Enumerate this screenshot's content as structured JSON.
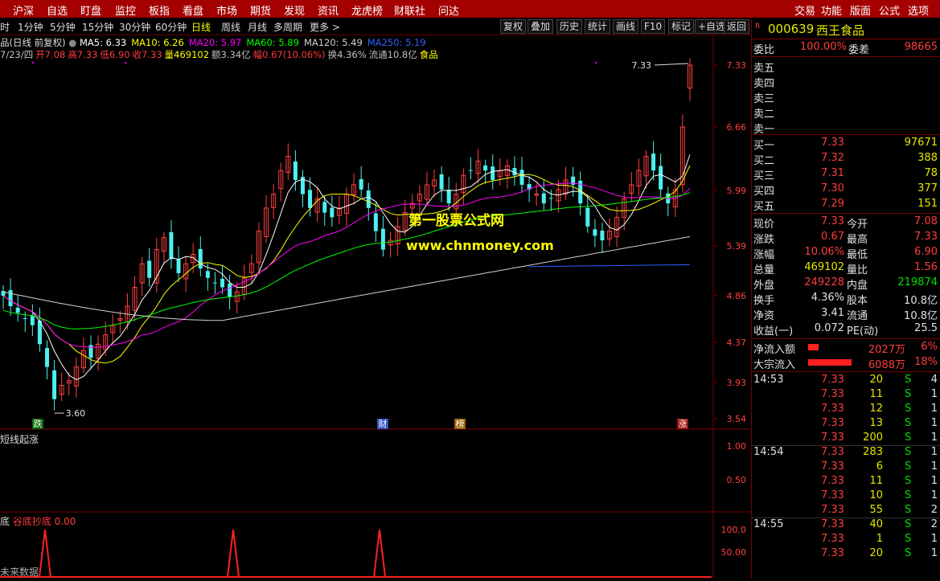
{
  "top_menu": [
    "沪深",
    "自选",
    "盯盘",
    "监控",
    "板指",
    "看盘",
    "市场",
    "期货",
    "发现",
    "资讯",
    "龙虎榜",
    "财联社",
    "问达"
  ],
  "top_right_menu": [
    "交易",
    "功能",
    "版面",
    "公式",
    "选项"
  ],
  "periods": [
    "时",
    "1分钟",
    "5分钟",
    "15分钟",
    "30分钟",
    "60分钟",
    "日线",
    "周线",
    "月线",
    "多周期",
    "更多 >"
  ],
  "active_period": "日线",
  "tool_buttons": [
    "复权",
    "叠加",
    "历史",
    "统计",
    "画线",
    "F10",
    "标记",
    "+自选",
    "返回"
  ],
  "chart_header": {
    "title": "品(日线 前复权)",
    "ma": [
      {
        "label": "MA5: 6.33",
        "color": "#ffffff"
      },
      {
        "label": "MA10: 6.26",
        "color": "#ffff00"
      },
      {
        "label": "MA20: 5.97",
        "color": "#ff00ff"
      },
      {
        "label": "MA60: 5.89",
        "color": "#00ff00"
      },
      {
        "label": "MA120: 5.49",
        "color": "#d0d0d0"
      },
      {
        "label": "MA250: 5.19",
        "color": "#3060ff"
      }
    ],
    "info": [
      {
        "t": "7/23/四",
        "c": "#c0c0c0"
      },
      {
        "t": "开7.08",
        "c": "#ff3c3c"
      },
      {
        "t": "高7.33",
        "c": "#ff3c3c"
      },
      {
        "t": "低6.90",
        "c": "#ff3c3c"
      },
      {
        "t": "收7.33",
        "c": "#ff3c3c"
      },
      {
        "t": "量469102",
        "c": "#ffff00"
      },
      {
        "t": "额3.34亿",
        "c": "#c0c0c0"
      },
      {
        "t": "幅0.67(10.06%)",
        "c": "#ff3c3c"
      },
      {
        "t": "换4.36%",
        "c": "#c0c0c0"
      },
      {
        "t": "流通10.8亿",
        "c": "#c0c0c0"
      },
      {
        "t": "食品",
        "c": "#ffff00"
      }
    ]
  },
  "watermark": {
    "line1": "第一股票公式网",
    "line2": "www.chnmoney.com"
  },
  "price_axis": [
    "7.33",
    "6.66",
    "5.99",
    "5.39",
    "4.86",
    "4.37",
    "3.93",
    "3.54"
  ],
  "annotations": {
    "high": "7.33",
    "low": "3.60"
  },
  "event_marks": [
    {
      "label": "跌",
      "bg": "#0a6a0a"
    },
    {
      "label": "财",
      "bg": "#3050c0"
    },
    {
      "label": "榜",
      "bg": "#a06000"
    },
    {
      "label": "涨",
      "bg": "#a01010"
    }
  ],
  "sub1": {
    "title": "短线起涨",
    "axis": [
      "1.00",
      "0.50"
    ]
  },
  "sub2": {
    "prefix": "底",
    "name": "谷底抄底",
    "value": "0.00",
    "axis": [
      "100.0",
      "50.00"
    ],
    "footer": "未来数据"
  },
  "chart_data": {
    "type": "candlestick",
    "symbol": "000639",
    "last": {
      "date": "7/23",
      "open": 7.08,
      "high": 7.33,
      "low": 6.9,
      "close": 7.33,
      "volume": 469102
    },
    "ma": {
      "MA5": 6.33,
      "MA10": 6.26,
      "MA20": 5.97,
      "MA60": 5.89,
      "MA120": 5.49,
      "MA250": 5.19
    },
    "price_ticks": [
      7.33,
      6.66,
      5.99,
      5.39,
      4.86,
      4.37,
      3.93,
      3.54
    ],
    "closes": [
      4.86,
      4.75,
      4.68,
      4.62,
      4.55,
      4.35,
      4.1,
      3.75,
      3.9,
      3.95,
      4.1,
      4.28,
      4.2,
      4.35,
      4.45,
      4.55,
      4.62,
      4.75,
      4.95,
      5.2,
      5.05,
      5.35,
      5.48,
      5.25,
      5.1,
      5.2,
      5.3,
      5.15,
      5.05,
      5.0,
      4.95,
      4.85,
      4.9,
      5.05,
      5.2,
      5.55,
      5.8,
      5.95,
      6.2,
      6.35,
      6.1,
      5.95,
      5.8,
      5.9,
      5.75,
      5.7,
      5.8,
      5.95,
      6.05,
      6.0,
      5.8,
      5.55,
      5.35,
      5.45,
      5.6,
      5.75,
      5.85,
      5.95,
      6.05,
      6.1,
      6.0,
      5.85,
      5.95,
      6.15,
      6.2,
      6.3,
      6.2,
      6.1,
      6.2,
      6.25,
      6.15,
      6.05,
      6.0,
      5.95,
      5.85,
      5.9,
      6.0,
      6.1,
      6.05,
      5.85,
      5.6,
      5.5,
      5.45,
      5.55,
      5.7,
      5.9,
      6.05,
      6.2,
      6.35,
      6.2,
      6.0,
      5.85,
      6.0,
      6.66,
      7.33
    ],
    "sub2_peaks_pct": [
      100,
      100,
      100
    ]
  },
  "quote": {
    "code": "000639",
    "name": "西王食品",
    "weibi": {
      "label": "委比",
      "value": "100.00%",
      "label2": "委差",
      "value2": "98665"
    },
    "sells": [
      {
        "label": "卖五"
      },
      {
        "label": "卖四"
      },
      {
        "label": "卖三"
      },
      {
        "label": "卖二"
      },
      {
        "label": "卖一"
      }
    ],
    "buys": [
      {
        "label": "买一",
        "price": "7.33",
        "vol": "97671"
      },
      {
        "label": "买二",
        "price": "7.32",
        "vol": "388"
      },
      {
        "label": "买三",
        "price": "7.31",
        "vol": "78"
      },
      {
        "label": "买四",
        "price": "7.30",
        "vol": "377"
      },
      {
        "label": "买五",
        "price": "7.29",
        "vol": "151"
      }
    ],
    "stats": [
      {
        "l1": "现价",
        "v1": "7.33",
        "c1": "red",
        "l2": "今开",
        "v2": "7.08",
        "c2": "red"
      },
      {
        "l1": "涨跌",
        "v1": "0.67",
        "c1": "red",
        "l2": "最高",
        "v2": "7.33",
        "c2": "red"
      },
      {
        "l1": "涨幅",
        "v1": "10.06%",
        "c1": "red",
        "l2": "最低",
        "v2": "6.90",
        "c2": "red"
      },
      {
        "l1": "总量",
        "v1": "469102",
        "c1": "yel",
        "l2": "量比",
        "v2": "1.56",
        "c2": "red"
      },
      {
        "l1": "外盘",
        "v1": "249228",
        "c1": "red",
        "l2": "内盘",
        "v2": "219874",
        "c2": "grn"
      },
      {
        "l1": "换手",
        "v1": "4.36%",
        "c1": "wht",
        "l2": "股本",
        "v2": "10.8亿",
        "c2": "wht"
      },
      {
        "l1": "净资",
        "v1": "3.41",
        "c1": "wht",
        "l2": "流通",
        "v2": "10.8亿",
        "c2": "wht"
      },
      {
        "l1": "收益(一)",
        "v1": "0.072",
        "c1": "wht",
        "l2": "PE(动)",
        "v2": "25.5",
        "c2": "wht"
      }
    ],
    "flows": [
      {
        "label": "净流入额",
        "value": "2027万",
        "pct": "6%",
        "bar": 0.22
      },
      {
        "label": "大宗流入",
        "value": "6088万",
        "pct": "18%",
        "bar": 0.9
      }
    ],
    "ticks": [
      {
        "time": "14:53",
        "price": "7.33",
        "vol": "20",
        "bs": "S",
        "n": "4"
      },
      {
        "time": "",
        "price": "7.33",
        "vol": "11",
        "bs": "S",
        "n": "1"
      },
      {
        "time": "",
        "price": "7.33",
        "vol": "12",
        "bs": "S",
        "n": "1"
      },
      {
        "time": "",
        "price": "7.33",
        "vol": "13",
        "bs": "S",
        "n": "1"
      },
      {
        "time": "",
        "price": "7.33",
        "vol": "200",
        "bs": "S",
        "n": "1"
      },
      {
        "time": "14:54",
        "price": "7.33",
        "vol": "283",
        "bs": "S",
        "n": "1"
      },
      {
        "time": "",
        "price": "7.33",
        "vol": "6",
        "bs": "S",
        "n": "1"
      },
      {
        "time": "",
        "price": "7.33",
        "vol": "11",
        "bs": "S",
        "n": "1"
      },
      {
        "time": "",
        "price": "7.33",
        "vol": "10",
        "bs": "S",
        "n": "1"
      },
      {
        "time": "",
        "price": "7.33",
        "vol": "55",
        "bs": "S",
        "n": "2"
      },
      {
        "time": "14:55",
        "price": "7.33",
        "vol": "40",
        "bs": "S",
        "n": "2"
      },
      {
        "time": "",
        "price": "7.33",
        "vol": "1",
        "bs": "S",
        "n": "1"
      },
      {
        "time": "",
        "price": "7.33",
        "vol": "20",
        "bs": "S",
        "n": "1"
      }
    ]
  }
}
